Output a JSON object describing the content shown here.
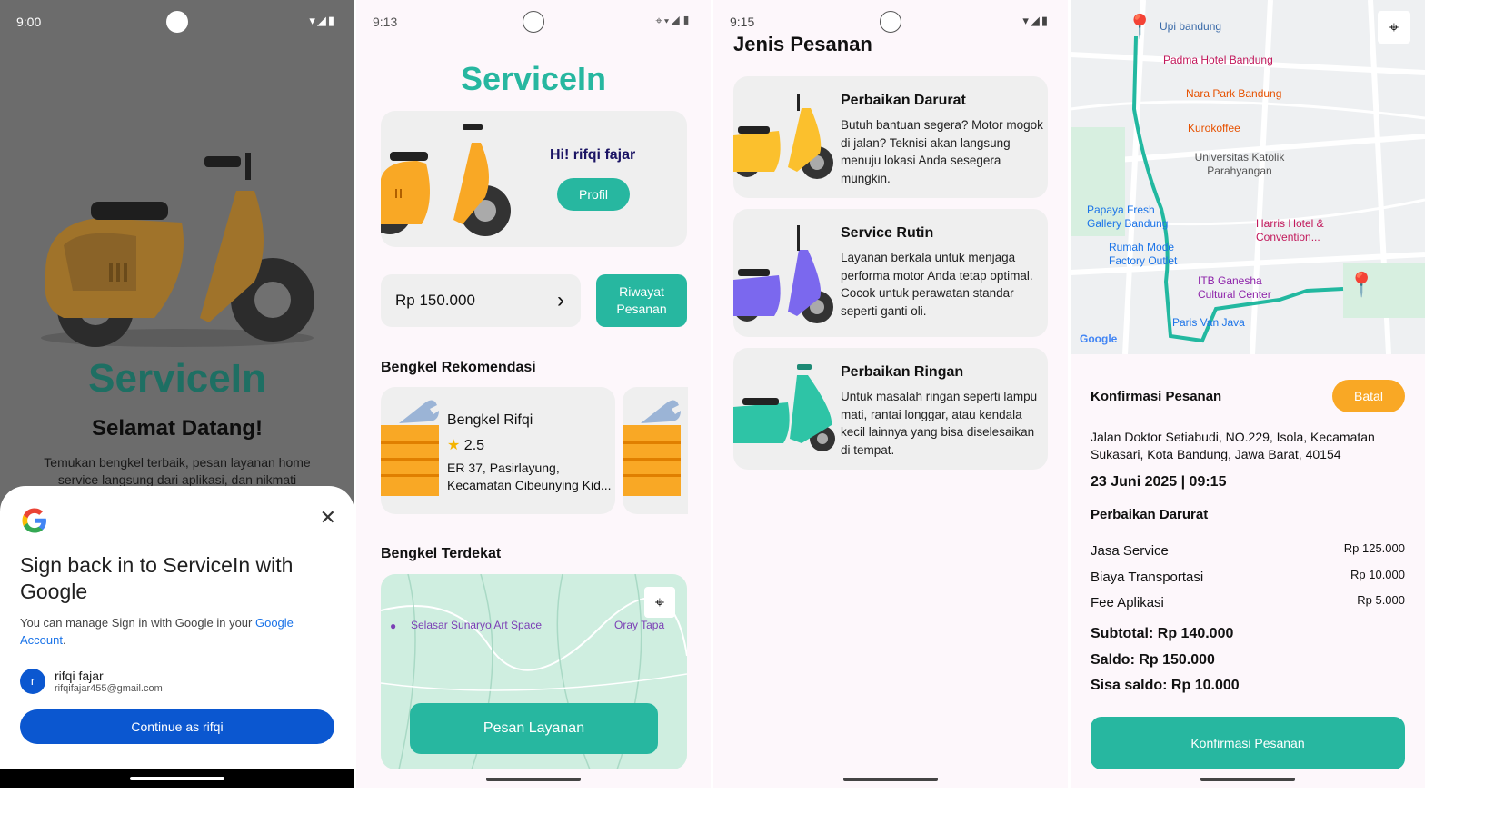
{
  "screen1": {
    "time": "9:00",
    "brand": "ServiceIn",
    "welcome": "Selamat Datang!",
    "description": "Temukan bengkel terbaik, pesan layanan home service langsung dari aplikasi, dan nikmati",
    "sheet": {
      "title": "Sign back in to ServiceIn with Google",
      "info": "You can manage Sign in with Google in your",
      "info_link": "Google Account",
      "account_initial": "r",
      "account_name": "rifqi fajar",
      "account_email": "rifqifajar455@gmail.com",
      "continue_label": "Continue as rifqi"
    }
  },
  "screen2": {
    "time": "9:13",
    "brand": "ServiceIn",
    "greeting": "Hi! rifqi fajar",
    "profile_button": "Profil",
    "balance": "Rp 150.000",
    "history_button": "Riwayat Pesanan",
    "recommend_title": "Bengkel Rekomendasi",
    "workshop": {
      "name": "Bengkel Rifqi",
      "rating": "2.5",
      "address": "ER 37, Pasirlayung, Kecamatan Cibeunying Kid..."
    },
    "nearby_title": "Bengkel Terdekat",
    "map_labels": [
      "Selasar Sunaryo Art Space",
      "Oray Tapa"
    ],
    "order_button": "Pesan Layanan"
  },
  "screen3": {
    "time": "9:15",
    "title": "Jenis Pesanan",
    "services": [
      {
        "title": "Perbaikan Darurat",
        "description": "Butuh bantuan segera? Motor mogok di jalan? Teknisi akan langsung menuju lokasi Anda sesegera mungkin."
      },
      {
        "title": "Service Rutin",
        "description": "Layanan berkala untuk menjaga performa motor Anda tetap optimal. Cocok untuk perawatan standar seperti ganti oli."
      },
      {
        "title": "Perbaikan Ringan",
        "description": "Untuk masalah ringan seperti lampu mati, rantai longgar, atau kendala kecil lainnya yang bisa diselesaikan di tempat."
      }
    ]
  },
  "screen4": {
    "map_labels": [
      "Upi bandung",
      "Padma Hotel Bandung",
      "Nara Park Bandung",
      "Kurokoffee",
      "Universitas Katolik Parahyangan",
      "Papaya Fresh Gallery Bandung",
      "Harris Hotel & Convention...",
      "Rumah Mode Factory Outlet",
      "ITB Ganesha Cultural Center",
      "Paris Van Java",
      "Google"
    ],
    "confirm_title": "Konfirmasi Pesanan",
    "cancel_button": "Batal",
    "address": "Jalan Doktor Setiabudi, NO.229, Isola, Kecamatan Sukasari, Kota Bandung, Jawa Barat, 40154",
    "datetime": "23 Juni 2025 | 09:15",
    "service": "Perbaikan Darurat",
    "costs": [
      {
        "label": "Jasa Service",
        "value": "Rp 125.000"
      },
      {
        "label": "Biaya Transportasi",
        "value": "Rp 10.000"
      },
      {
        "label": "Fee Aplikasi",
        "value": "Rp 5.000"
      }
    ],
    "subtotal": "Subtotal: Rp 140.000",
    "saldo": "Saldo: Rp 150.000",
    "remaining": "Sisa saldo: Rp 10.000",
    "confirm_button": "Konfirmasi Pesanan"
  },
  "colors": {
    "accent": "#27b7a0",
    "orange": "#f9a825",
    "google_blue": "#0b57d0"
  }
}
